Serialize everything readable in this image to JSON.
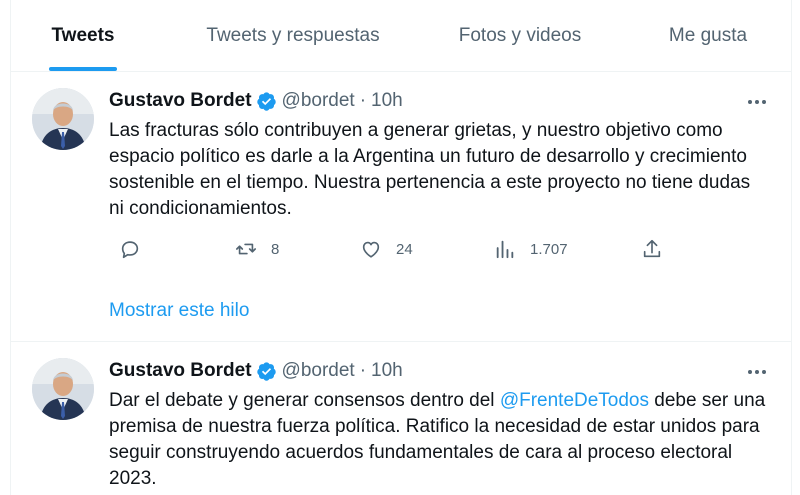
{
  "tabs": [
    {
      "label": "Tweets",
      "active": true
    },
    {
      "label": "Tweets y respuestas",
      "active": false
    },
    {
      "label": "Fotos y videos",
      "active": false
    },
    {
      "label": "Me gusta",
      "active": false
    }
  ],
  "tweets": [
    {
      "author_name": "Gustavo Bordet",
      "handle": "@bordet",
      "separator": "·",
      "time": "10h",
      "text": "Las fracturas sólo contribuyen a generar grietas, y nuestro objetivo como espacio político es darle a la Argentina un futuro de desarrollo y crecimiento sostenible en el tiempo. Nuestra pertenencia a este proyecto no tiene dudas ni condicionamientos.",
      "replies": "",
      "retweets": "8",
      "likes": "24",
      "views": "1.707",
      "show_thread": "Mostrar este hilo"
    },
    {
      "author_name": "Gustavo Bordet",
      "handle": "@bordet",
      "separator": "·",
      "time": "10h",
      "text_before": "Dar el debate y generar consensos dentro del ",
      "mention": "@FrenteDeTodos",
      "text_after": " debe ser una premisa de nuestra fuerza política. Ratifico la necesidad de estar unidos para seguir construyendo acuerdos fundamentales de cara al proceso electoral 2023."
    }
  ],
  "colors": {
    "accent": "#1d9bf0",
    "text_primary": "#0f1419",
    "text_secondary": "#536471",
    "border": "#eff3f4"
  },
  "icons": [
    "verified-badge-icon",
    "more-options-icon",
    "reply-icon",
    "retweet-icon",
    "like-icon",
    "views-icon",
    "share-icon"
  ]
}
